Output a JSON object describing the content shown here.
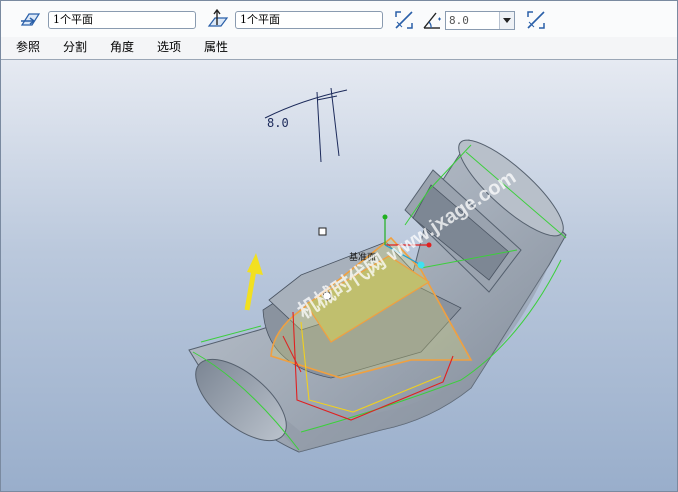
{
  "toolbar": {
    "field1_value": "1个平面",
    "field2_value": "1个平面",
    "angle_value": "8.0"
  },
  "menu": {
    "items": [
      "参照",
      "分割",
      "角度",
      "选项",
      "属性"
    ]
  },
  "viewport": {
    "dimension_label": "8.0",
    "plane_label": "基准面",
    "watermark": "机械时代网 www.jxage.com"
  },
  "colors": {
    "background_top": "#e6eaf2",
    "background_bottom": "#99aecb",
    "part_body": "#a9b2bd",
    "edge_highlight": "#3ccf3c",
    "selection_orange": "#f0a040",
    "direction_arrow": "#f2e020"
  },
  "icons": {
    "reference_icon": "reference-plane-icon",
    "pull_direction_icon": "pull-direction-icon",
    "flip_icon": "flip-direction-icon",
    "draft_angle_icon": "draft-angle-icon"
  }
}
